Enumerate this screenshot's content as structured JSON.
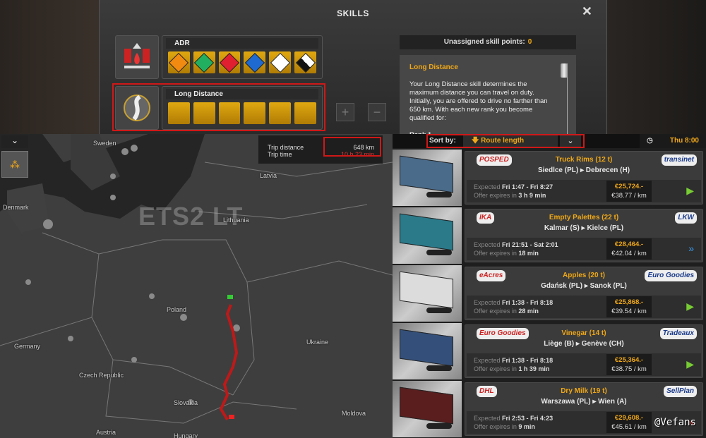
{
  "skills_window": {
    "title": "SKILLS",
    "close_icon": "close-icon",
    "adr": {
      "label": "ADR",
      "classes": [
        "Explosives",
        "Gases",
        "Flammable liquids",
        "Flammable solids",
        "Toxic",
        "Corrosive"
      ],
      "colors": [
        "#f08a10",
        "#22b060",
        "#e02030",
        "#1e6ad0",
        "#ffffff",
        "#ffffff"
      ]
    },
    "long_distance": {
      "label": "Long Distance",
      "ranks_total": 6
    },
    "plus_label": "+",
    "minus_label": "−",
    "unassigned_label": "Unassigned skill points:",
    "unassigned_value": "0",
    "description": {
      "heading": "Long Distance",
      "text": "Your Long Distance skill determines the maximum distance you can travel on duty. Initially, you are offered to drive no farther than 650 km. With each new rank you become qualified for:",
      "rank": "Rank 1"
    }
  },
  "map": {
    "watermark": "ETS2 LT",
    "labels": [
      "Sweden",
      "Latvia",
      "Denmark",
      "Lithuania",
      "Poland",
      "Germany",
      "Ukraine",
      "Czech Republic",
      "Slovakia",
      "Moldova",
      "Austria",
      "Hungary"
    ],
    "trip_distance_label": "Trip distance",
    "trip_distance_value": "648 km",
    "trip_time_label": "Trip time",
    "trip_time_value": "10 h 23 min"
  },
  "jobs_panel": {
    "sort_label": "Sort by:",
    "sort_value": "Route length",
    "time": "Thu 8:00",
    "jobs": [
      {
        "from_company": "POSPED",
        "to_company": "transinet",
        "cargo": "Truck Rims (12 t)",
        "route_from": "Siedlce (PL)",
        "route_to": "Debrecen (H)",
        "expected_label": "Expected",
        "expected": "Fri 1:47 - Fri 8:27",
        "expires_label": "Offer expires in",
        "expires": "3 h 9 min",
        "price": "€25,724.-",
        "per_km": "€38.77 / km",
        "trailer_color": "#4a6b8a"
      },
      {
        "from_company": "IKA",
        "to_company": "LKW",
        "cargo": "Empty Palettes (22 t)",
        "route_from": "Kalmar (S)",
        "route_to": "Kielce (PL)",
        "expected_label": "Expected",
        "expected": "Fri 21:51 - Sat 2:01",
        "expires_label": "Offer expires in",
        "expires": "18 min",
        "price": "€28,464.-",
        "per_km": "€42.04 / km",
        "trailer_color": "#2a7a8a"
      },
      {
        "from_company": "eAcres",
        "to_company": "Euro Goodies",
        "cargo": "Apples (20 t)",
        "route_from": "Gdańsk (PL)",
        "route_to": "Sanok (PL)",
        "expected_label": "Expected",
        "expected": "Fri 1:38 - Fri 8:18",
        "expires_label": "Offer expires in",
        "expires": "28 min",
        "price": "€25,868.-",
        "per_km": "€39.54 / km",
        "trailer_color": "#dcdcdc"
      },
      {
        "from_company": "Euro Goodies",
        "to_company": "Tradeaux",
        "cargo": "Vinegar (14 t)",
        "route_from": "Liège (B)",
        "route_to": "Genève (CH)",
        "expected_label": "Expected",
        "expected": "Fri 1:38 - Fri 8:18",
        "expires_label": "Offer expires in",
        "expires": "1 h 39 min",
        "price": "€25,364.-",
        "per_km": "€38.75 / km",
        "trailer_color": "#34507a"
      },
      {
        "from_company": "DHL",
        "to_company": "SellPlan",
        "cargo": "Dry Milk (19 t)",
        "route_from": "Warszawa (PL)",
        "route_to": "Wien (A)",
        "expected_label": "Expected",
        "expected": "Fri 2:53 - Fri 4:23",
        "expires_label": "Offer expires in",
        "expires": "9 min",
        "price": "€29,608.-",
        "per_km": "€45.61 / km",
        "trailer_color": "#5a1e1e"
      }
    ]
  },
  "credit": "@Vefans"
}
